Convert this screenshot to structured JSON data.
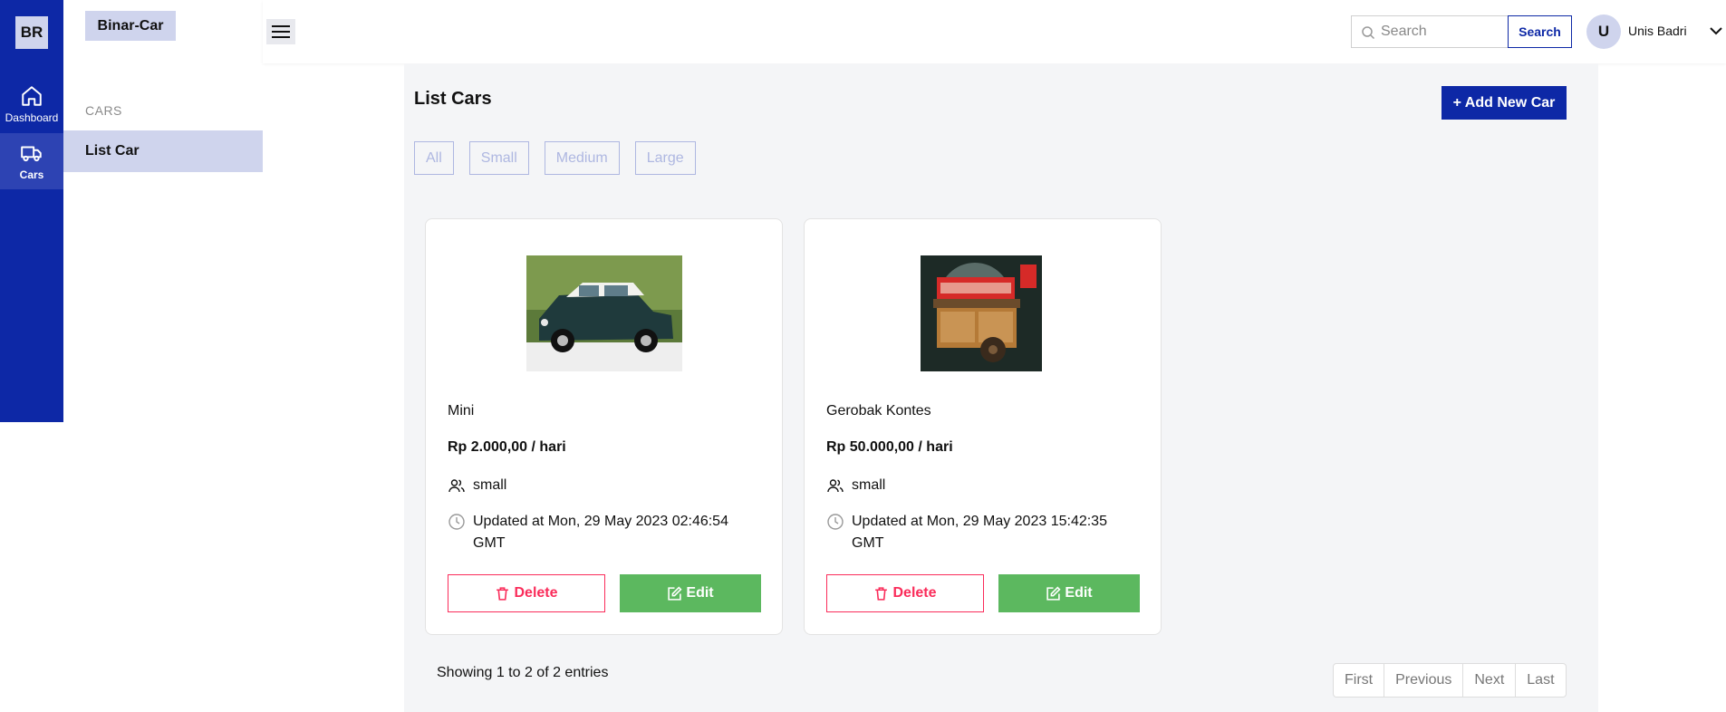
{
  "rail": {
    "logo": "BR",
    "items": [
      {
        "label": "Dashboard",
        "icon": "home-icon"
      },
      {
        "label": "Cars",
        "icon": "truck-icon"
      }
    ]
  },
  "sidebar": {
    "brand": "Binar-Car",
    "heading": "CARS",
    "active_item": "List Car"
  },
  "topbar": {
    "menu_icon": "hamburger-icon",
    "search_placeholder": "Search",
    "search_button": "Search",
    "avatar_initial": "U",
    "user_name": "Unis Badri"
  },
  "main": {
    "title": "List Cars",
    "add_button": "+ Add New Car",
    "filters": [
      "All",
      "Small",
      "Medium",
      "Large"
    ],
    "cars": [
      {
        "name": "Mini",
        "price": "Rp 2.000,00 / hari",
        "capacity": "small",
        "updated": "Updated at Mon, 29 May 2023 02:46:54 GMT",
        "delete_label": "Delete",
        "edit_label": "Edit"
      },
      {
        "name": "Gerobak Kontes",
        "price": "Rp 50.000,00 / hari",
        "capacity": "small",
        "updated": "Updated at Mon, 29 May 2023 15:42:35 GMT",
        "delete_label": "Delete",
        "edit_label": "Edit"
      }
    ],
    "entries_text": "Showing 1 to 2 of 2 entries",
    "pagination": [
      "First",
      "Previous",
      "Next",
      "Last"
    ]
  },
  "colors": {
    "primary": "#0d28a6",
    "accent_light": "#cfd4ed",
    "danger": "#fa2c5a",
    "success": "#5cb85f"
  }
}
